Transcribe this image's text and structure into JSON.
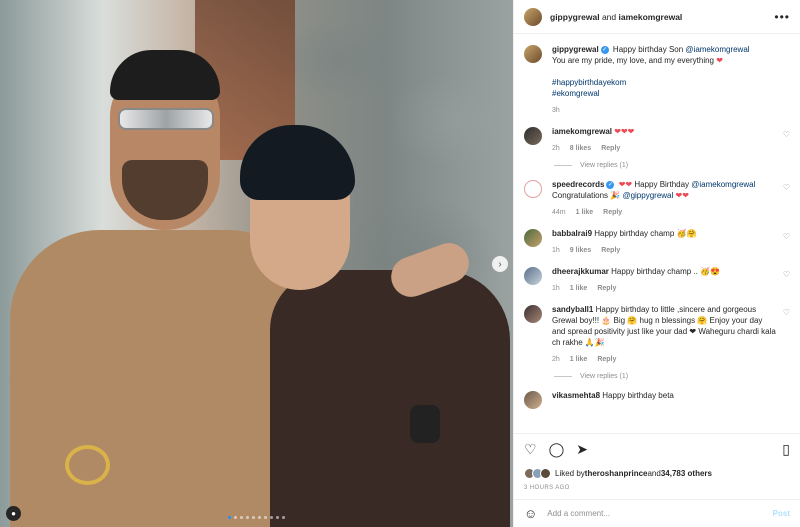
{
  "header": {
    "user1": "gippygrewal",
    "conj": " and ",
    "user2": "iamekomgrewal",
    "more": "•••"
  },
  "caption": {
    "username": "gippygrewal",
    "text1": "Happy birthday Son ",
    "mention": "@iamekomgrewal",
    "line2": "You are my pride, my love, and my everything",
    "hashtag1": "#happybirthdayekom",
    "hashtag2": "#ekomgrewal",
    "time": "3h"
  },
  "comments": [
    {
      "username": "iamekomgrewal",
      "text": "",
      "hearts": "❤❤❤",
      "time": "2h",
      "likes": "8 likes",
      "reply": "Reply",
      "view_replies": "View replies (1)"
    },
    {
      "username": "speedrecords",
      "text": "Happy Birthday ",
      "mention": "@iamekomgrewal",
      "line2": "Congratulations ",
      "mention2": "@gippygrewal",
      "time": "44m",
      "likes": "1 like",
      "reply": "Reply"
    },
    {
      "username": "babbalrai9",
      "text": "Happy birthday champ 🥳🤗",
      "time": "1h",
      "likes": "9 likes",
      "reply": "Reply"
    },
    {
      "username": "dheerajkkumar",
      "text": "Happy birthday champ .. 🥳😍",
      "time": "1h",
      "likes": "1 like",
      "reply": "Reply"
    },
    {
      "username": "sandyball1",
      "text": "Happy birthday to little ,sincere and gorgeous Grewal boy!!! 🎂 Big 🤗 hug n blessings 🤗 Enjoy your day and spread positivity just like your dad ❤ Waheguru chardi kala ch rakhe 🙏🎉",
      "time": "2h",
      "likes": "1 like",
      "reply": "Reply",
      "view_replies": "View replies (1)"
    },
    {
      "username": "vikasmehta8",
      "text": "Happy birthday beta"
    }
  ],
  "likes": {
    "prefix": "Liked by ",
    "user": "theroshanprince",
    "suffix": " and ",
    "count": "34,783 others"
  },
  "time_ago": "3 HOURS AGO",
  "comment_input": {
    "placeholder": "Add a comment..."
  },
  "post_label": "Post",
  "icons": {
    "heart": "heart-icon",
    "comment": "comment-icon",
    "share": "share-icon",
    "save": "bookmark-icon",
    "emoji": "emoji-icon",
    "tag": "person-tag-icon",
    "next": "chevron-right-icon"
  },
  "colors": {
    "link": "#00376b",
    "verified": "#3897f0",
    "heart": "#ed4956",
    "muted": "#8e8e8e"
  }
}
